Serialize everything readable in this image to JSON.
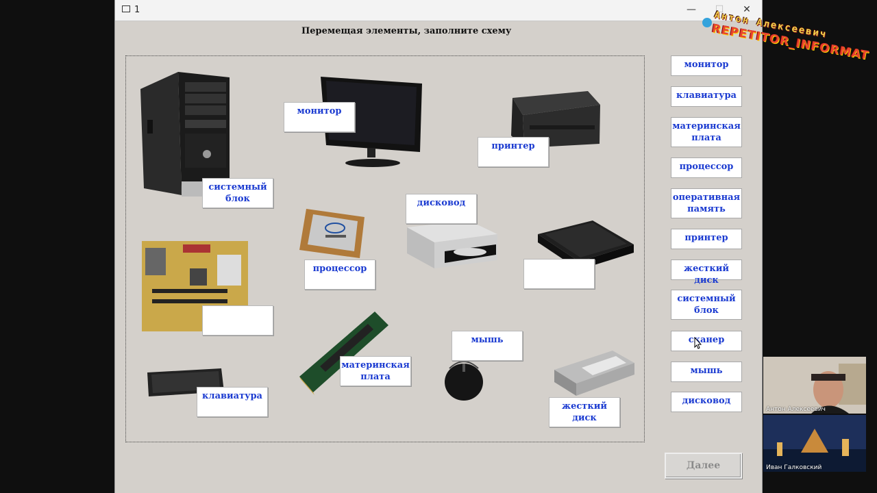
{
  "window": {
    "title": "1",
    "minimize": "—",
    "maximize": "☐",
    "close": "✕"
  },
  "heading": "Перемещая элементы, заполните схему",
  "slots": [
    {
      "name": "slot-monitor",
      "text": "монитор"
    },
    {
      "name": "slot-printer",
      "text": "принтер"
    },
    {
      "name": "slot-system-unit",
      "text": "системный блок"
    },
    {
      "name": "slot-drive",
      "text": "дисковод"
    },
    {
      "name": "slot-processor",
      "text": "процессор"
    },
    {
      "name": "slot-scanner",
      "text": ""
    },
    {
      "name": "slot-motherboard-photo",
      "text": ""
    },
    {
      "name": "slot-mouse",
      "text": "мышь"
    },
    {
      "name": "slot-ram-photo",
      "text": "материнская плата"
    },
    {
      "name": "slot-keyboard",
      "text": "клавиатура"
    },
    {
      "name": "slot-hdd",
      "text": "жесткий диск"
    }
  ],
  "options": [
    "монитор",
    "клавиатура",
    "материнская плата",
    "процессор",
    "оперативная память",
    "принтер",
    "жесткий диск",
    "системный блок",
    "сканер",
    "мышь",
    "дисковод"
  ],
  "next_button": "Далее",
  "branding": {
    "name": "Антон Алексеевич",
    "site": "REPETITOR_INFORMAT"
  },
  "video_participants": [
    "Антон Алексеевич",
    "Иван Галковский"
  ],
  "colors": {
    "window_bg": "#d4d0cb",
    "label_text": "#1b3bd1",
    "outer_bg": "#0f0f0f"
  }
}
